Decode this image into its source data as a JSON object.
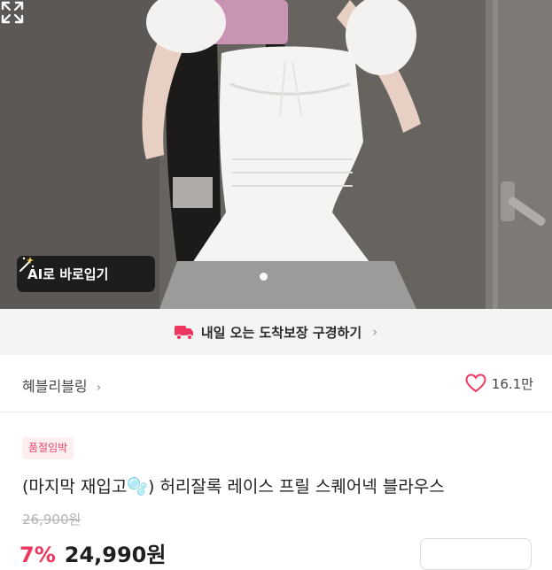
{
  "photo": {
    "ai_button_label": "AI로 바로입기",
    "ai_icon": "magic-wand-icon",
    "expand_icon": "expand-icon",
    "pager_active_index": 1
  },
  "delivery": {
    "text": "내일 오는 도착보장 구경하기",
    "icon": "truck-icon",
    "accent_color": "#f0355e"
  },
  "brand": {
    "name": "혜블리블링",
    "chevron": "›",
    "likes": "16.1만",
    "like_icon": "heart-outline-icon"
  },
  "product": {
    "badge": "품절임박",
    "title": "(마지막 재입고🫧) 허리잘록 레이스 프릴 스퀘어넥 블라우스",
    "original_price": "26,900원",
    "discount": "7%",
    "price": "24,990원"
  },
  "colors": {
    "accent": "#f0355e",
    "badge_bg": "#fdeff0",
    "banner_bg": "#f4f4f5"
  }
}
